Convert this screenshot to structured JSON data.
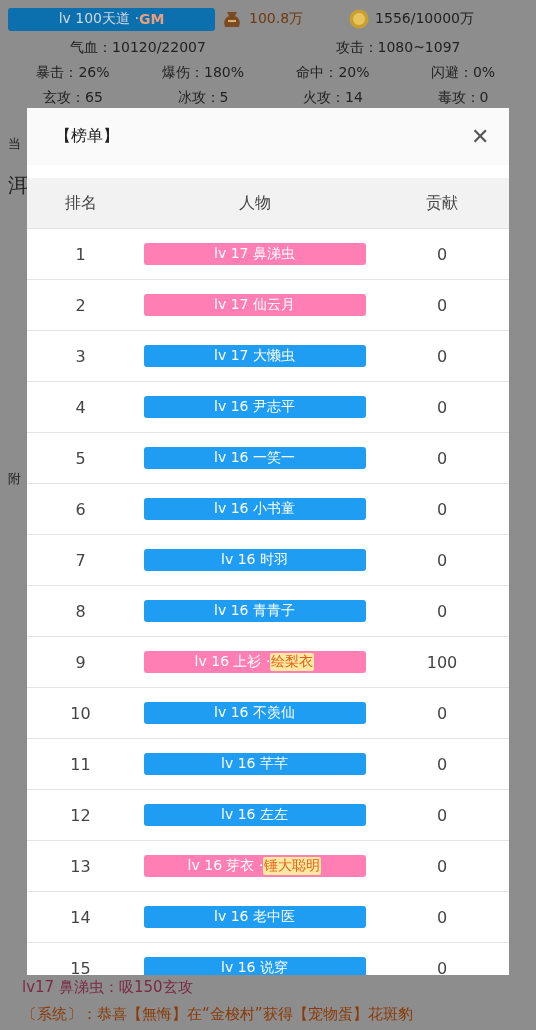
{
  "player": {
    "level": "lv 100天道 · ",
    "tag": "GM",
    "bag": "100.8万",
    "coins": "1556/10000万"
  },
  "stats": [
    [
      "气血：10120/22007",
      "攻击：1080~1097"
    ],
    [
      "暴击：26%",
      "爆伤：180%",
      "命中：20%",
      "闪避：0%"
    ],
    [
      "玄攻：65",
      "冰攻：5",
      "火攻：14",
      "毒攻：0"
    ]
  ],
  "background_fragments": [
    "当",
    "洱",
    "附"
  ],
  "log": [
    {
      "text": "lv17 鼻涕虫：吸150玄攻",
      "color": "#7a2a45"
    },
    {
      "text": "〔系统〕：恭喜【無悔】在“金梭村”获得【宠物蛋】花斑豹",
      "color": "#8a3a0a"
    }
  ],
  "dialog": {
    "title": "【榜单】",
    "close": "✕",
    "columns": [
      "排名",
      "人物",
      "贡献"
    ],
    "rows": [
      {
        "rank": "1",
        "name": "lv 17 鼻涕虫",
        "color": "#ff7eb3",
        "score": "0"
      },
      {
        "rank": "2",
        "name": "lv 17 仙云月",
        "color": "#ff7eb3",
        "score": "0"
      },
      {
        "rank": "3",
        "name": "lv 17 大懒虫",
        "color": "#1e9df2",
        "score": "0"
      },
      {
        "rank": "4",
        "name": "lv 16 尹志平",
        "color": "#1e9df2",
        "score": "0"
      },
      {
        "rank": "5",
        "name": "lv 16 一笑一",
        "color": "#1e9df2",
        "score": "0"
      },
      {
        "rank": "6",
        "name": "lv 16 小书童",
        "color": "#1e9df2",
        "score": "0"
      },
      {
        "rank": "7",
        "name": "lv 16 时羽",
        "color": "#1e9df2",
        "score": "0"
      },
      {
        "rank": "8",
        "name": "lv 16 青青子",
        "color": "#1e9df2",
        "score": "0"
      },
      {
        "rank": "9",
        "name": "lv 16 上衫 · ",
        "title": "绘梨衣",
        "color": "#ff7eb3",
        "score": "100"
      },
      {
        "rank": "10",
        "name": "lv 16 不羡仙",
        "color": "#1e9df2",
        "score": "0"
      },
      {
        "rank": "11",
        "name": "lv 16 芊芊",
        "color": "#1e9df2",
        "score": "0"
      },
      {
        "rank": "12",
        "name": "lv 16 左左",
        "color": "#1e9df2",
        "score": "0"
      },
      {
        "rank": "13",
        "name": "lv 16 芽衣 · ",
        "title": "锤大聪明",
        "color": "#ff7eb3",
        "score": "0"
      },
      {
        "rank": "14",
        "name": "lv 16 老中医",
        "color": "#1e9df2",
        "score": "0"
      },
      {
        "rank": "15",
        "name": "lv 16 说穿",
        "color": "#1e9df2",
        "score": "0"
      }
    ]
  }
}
